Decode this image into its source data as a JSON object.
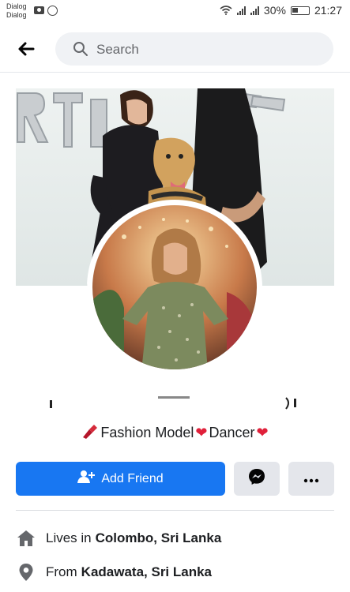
{
  "status_bar": {
    "carrier_line1": "Dialog",
    "carrier_line2": "Dialog",
    "battery": "30%",
    "time": "21:27"
  },
  "search": {
    "placeholder": "Search"
  },
  "profile": {
    "bio_prefix_emoji": "lipstick",
    "bio_part1": "Fashion Model",
    "bio_part2": "Dancer",
    "actions": {
      "add_friend": "Add Friend"
    }
  },
  "details": [
    {
      "prefix": "Lives in",
      "value": "Colombo, Sri Lanka",
      "icon": "home-icon"
    },
    {
      "prefix": "From",
      "value": "Kadawata, Sri Lanka",
      "icon": "location-pin-icon"
    }
  ],
  "colors": {
    "primary": "#1877f2",
    "secondary_button": "#e4e6eb",
    "search_bg": "#f0f2f5",
    "heart": "#e0203a"
  }
}
